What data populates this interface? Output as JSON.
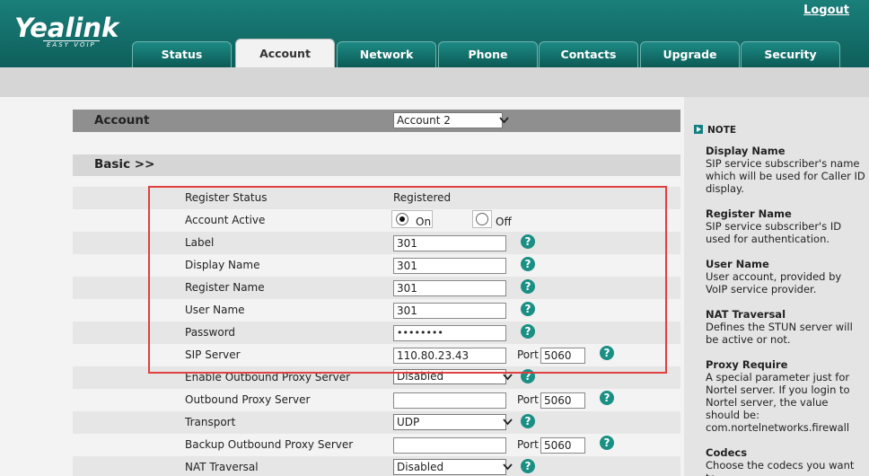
{
  "header": {
    "logo": "Yealink",
    "logo_sub": "EASY VOIP",
    "logout": "Logout",
    "tabs": [
      "Status",
      "Account",
      "Network",
      "Phone",
      "Contacts",
      "Upgrade",
      "Security"
    ],
    "active_tab": "Account"
  },
  "account": {
    "label": "Account",
    "selected": "Account 2"
  },
  "basic": {
    "label": "Basic >>"
  },
  "fields": {
    "register_status": {
      "label": "Register Status",
      "value": "Registered"
    },
    "account_active": {
      "label": "Account Active",
      "on": "On",
      "off": "Off",
      "selected": "On"
    },
    "label": {
      "label": "Label",
      "value": "301"
    },
    "display_name": {
      "label": "Display Name",
      "value": "301"
    },
    "register_name": {
      "label": "Register Name",
      "value": "301"
    },
    "user_name": {
      "label": "User Name",
      "value": "301"
    },
    "password": {
      "label": "Password",
      "value": "••••••••"
    },
    "sip_server": {
      "label": "SIP Server",
      "value": "110.80.23.43",
      "port_label": "Port",
      "port": "5060"
    },
    "enable_outbound_proxy": {
      "label": "Enable Outbound Proxy Server",
      "value": "Disabled"
    },
    "outbound_proxy": {
      "label": "Outbound Proxy Server",
      "value": "",
      "port_label": "Port",
      "port": "5060"
    },
    "transport": {
      "label": "Transport",
      "value": "UDP"
    },
    "backup_outbound_proxy": {
      "label": "Backup Outbound Proxy Server",
      "value": "",
      "port_label": "Port",
      "port": "5060"
    },
    "nat_traversal": {
      "label": "NAT Traversal",
      "value": "Disabled"
    }
  },
  "note": {
    "heading": "NOTE",
    "items": [
      {
        "title": "Display Name",
        "text": "SIP service subscriber's name which will be used for Caller ID display."
      },
      {
        "title": "Register Name",
        "text": "SIP service subscriber's ID used for authentication."
      },
      {
        "title": "User Name",
        "text": "User account, provided by VoIP service provider."
      },
      {
        "title": "NAT Traversal",
        "text": "Defines the STUN server will be active or not."
      },
      {
        "title": "Proxy Require",
        "text": "A special parameter just for Nortel server. If you login to Nortel server, the value should be: com.nortelnetworks.firewall"
      },
      {
        "title": "Codecs",
        "text": "Choose the codecs you want to"
      }
    ]
  },
  "icons": {
    "help": "help-icon",
    "dropdown": "chevron-down-icon",
    "note": "note-arrow-icon"
  },
  "colors": {
    "header": "#0e5f5b",
    "highlight": "#e04040",
    "help": "#1a8f84"
  }
}
